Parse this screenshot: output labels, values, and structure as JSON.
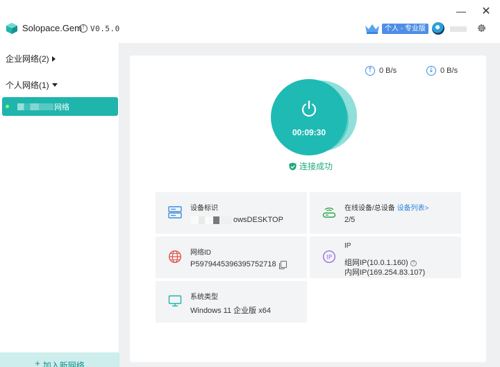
{
  "window": {
    "app_title": "Solopace.Gem",
    "version": "V0.5.0",
    "minimize_icon": "minimize-icon",
    "close_icon": "close-icon"
  },
  "header": {
    "vip_label": "个人 - 专业版",
    "vip_icon": "crown-icon",
    "settings_icon": "gear-icon"
  },
  "sidebar": {
    "groups": [
      {
        "label": "企业网络(2)",
        "expanded": false
      },
      {
        "label": "个人网络(1)",
        "expanded": true
      }
    ],
    "networks": [
      {
        "label": "网络",
        "online": true
      }
    ],
    "add_network_label": "加入新网络"
  },
  "traffic": {
    "upload": "0 B/s",
    "download": "0 B/s"
  },
  "connection": {
    "timer": "00:09:30",
    "status": "连接成功"
  },
  "info": {
    "device_id": {
      "label": "设备标识",
      "value": "owsDESKTOP"
    },
    "devices": {
      "label": "在线设备/总设备",
      "link": "设备列表>",
      "value": "2/5"
    },
    "network_id": {
      "label": "网络ID",
      "value": "P5979445396395752718"
    },
    "ip": {
      "label": "IP",
      "group_ip": "组网IP(10.0.1.160)",
      "lan_ip": "内网IP(169.254.83.107)"
    },
    "system": {
      "label": "系统类型",
      "value": "Windows 11 企业版 x64"
    }
  },
  "colors": {
    "accent": "#1fb5ad",
    "link": "#2f86e0",
    "status_ok": "#1faa7a"
  }
}
